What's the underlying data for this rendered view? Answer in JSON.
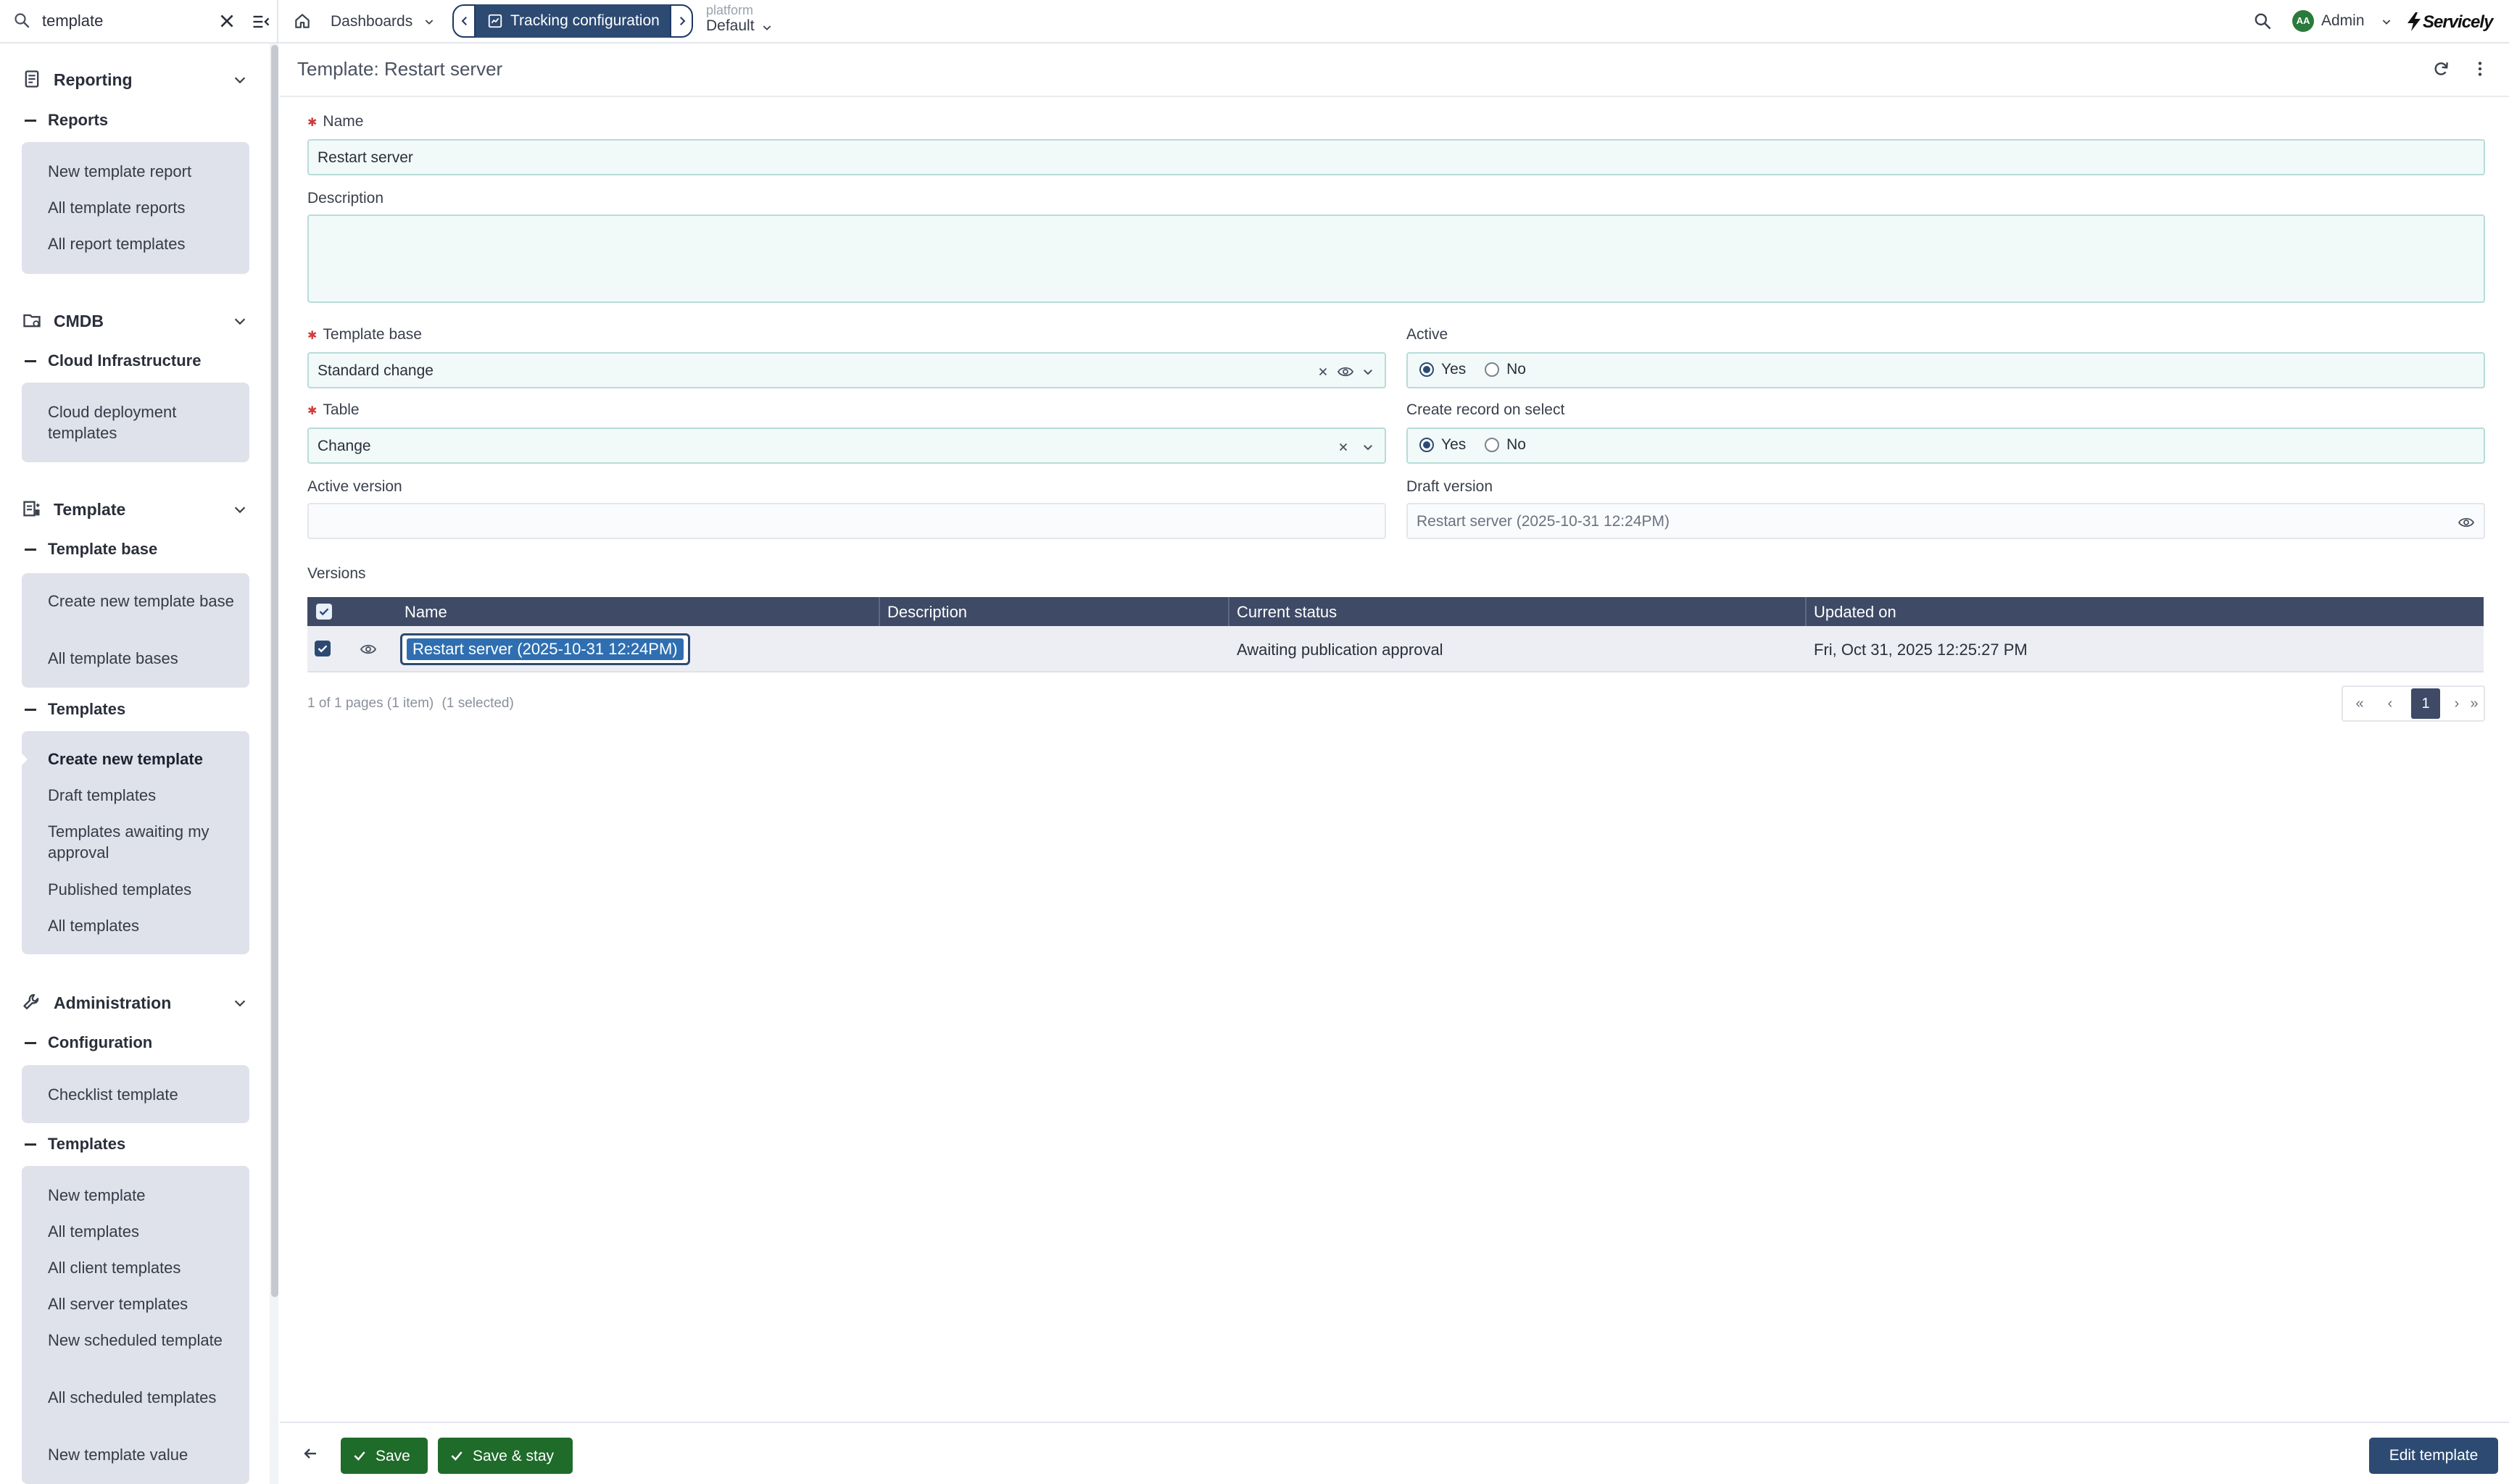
{
  "search": {
    "value": "template"
  },
  "sidebar": {
    "reporting": {
      "title": "Reporting",
      "groups": [
        {
          "title": "Reports",
          "items": [
            "New template report",
            "All template reports",
            "All report templates"
          ]
        }
      ]
    },
    "cmdb": {
      "title": "CMDB",
      "groups": [
        {
          "title": "Cloud Infrastructure",
          "items": [
            "Cloud deployment templates"
          ]
        }
      ]
    },
    "template": {
      "title": "Template",
      "groups": [
        {
          "title": "Template base",
          "items": [
            "Create new template base",
            "All template bases"
          ]
        },
        {
          "title": "Templates",
          "items": [
            "Create new template",
            "Draft templates",
            "Templates awaiting my approval",
            "Published templates",
            "All templates"
          ]
        }
      ]
    },
    "administration": {
      "title": "Administration",
      "groups": [
        {
          "title": "Configuration",
          "items": [
            "Checklist template"
          ]
        },
        {
          "title": "Templates",
          "items": [
            "New template",
            "All templates",
            "All client templates",
            "All server templates",
            "New scheduled template",
            "All scheduled templates",
            "New template value"
          ]
        }
      ]
    },
    "active_item": "Create new template"
  },
  "topbar": {
    "dashboards_label": "Dashboards",
    "active_tab_label": "Tracking configuration",
    "platform_label": "platform",
    "platform_value": "Default",
    "user_initials": "AA",
    "user_label": "Admin",
    "brand": "Servicely"
  },
  "page": {
    "title": "Template: Restart server"
  },
  "form": {
    "name": {
      "label": "Name",
      "value": "Restart server"
    },
    "description": {
      "label": "Description",
      "value": ""
    },
    "template_base": {
      "label": "Template base",
      "value": "Standard change"
    },
    "active": {
      "label": "Active",
      "yes": "Yes",
      "no": "No",
      "selected": "Yes"
    },
    "table": {
      "label": "Table",
      "value": "Change"
    },
    "create_record": {
      "label": "Create record on select",
      "yes": "Yes",
      "no": "No",
      "selected": "Yes"
    },
    "active_version": {
      "label": "Active version",
      "value": ""
    },
    "draft_version": {
      "label": "Draft version",
      "value": "Restart server (2025-10-31 12:24PM)"
    }
  },
  "versions": {
    "label": "Versions",
    "columns": [
      "Name",
      "Description",
      "Current status",
      "Updated on"
    ],
    "rows": [
      {
        "name": "Restart server (2025-10-31 12:24PM)",
        "description": "",
        "status": "Awaiting publication approval",
        "updated": "Fri, Oct 31, 2025 12:25:27 PM"
      }
    ],
    "pagination_info": "1 of 1 pages (1 item)",
    "selection_info": "(1 selected)",
    "current_page": "1"
  },
  "footer": {
    "save_label": "Save",
    "save_stay_label": "Save & stay",
    "edit_label": "Edit template"
  },
  "colors": {
    "accent": "#2c4a72",
    "grid_header": "#3e4a66",
    "save_green": "#1f6b2a",
    "required": "#d23c3c",
    "sidebar_box": "#dfe2ea",
    "field_bg": "#f1faf9"
  }
}
